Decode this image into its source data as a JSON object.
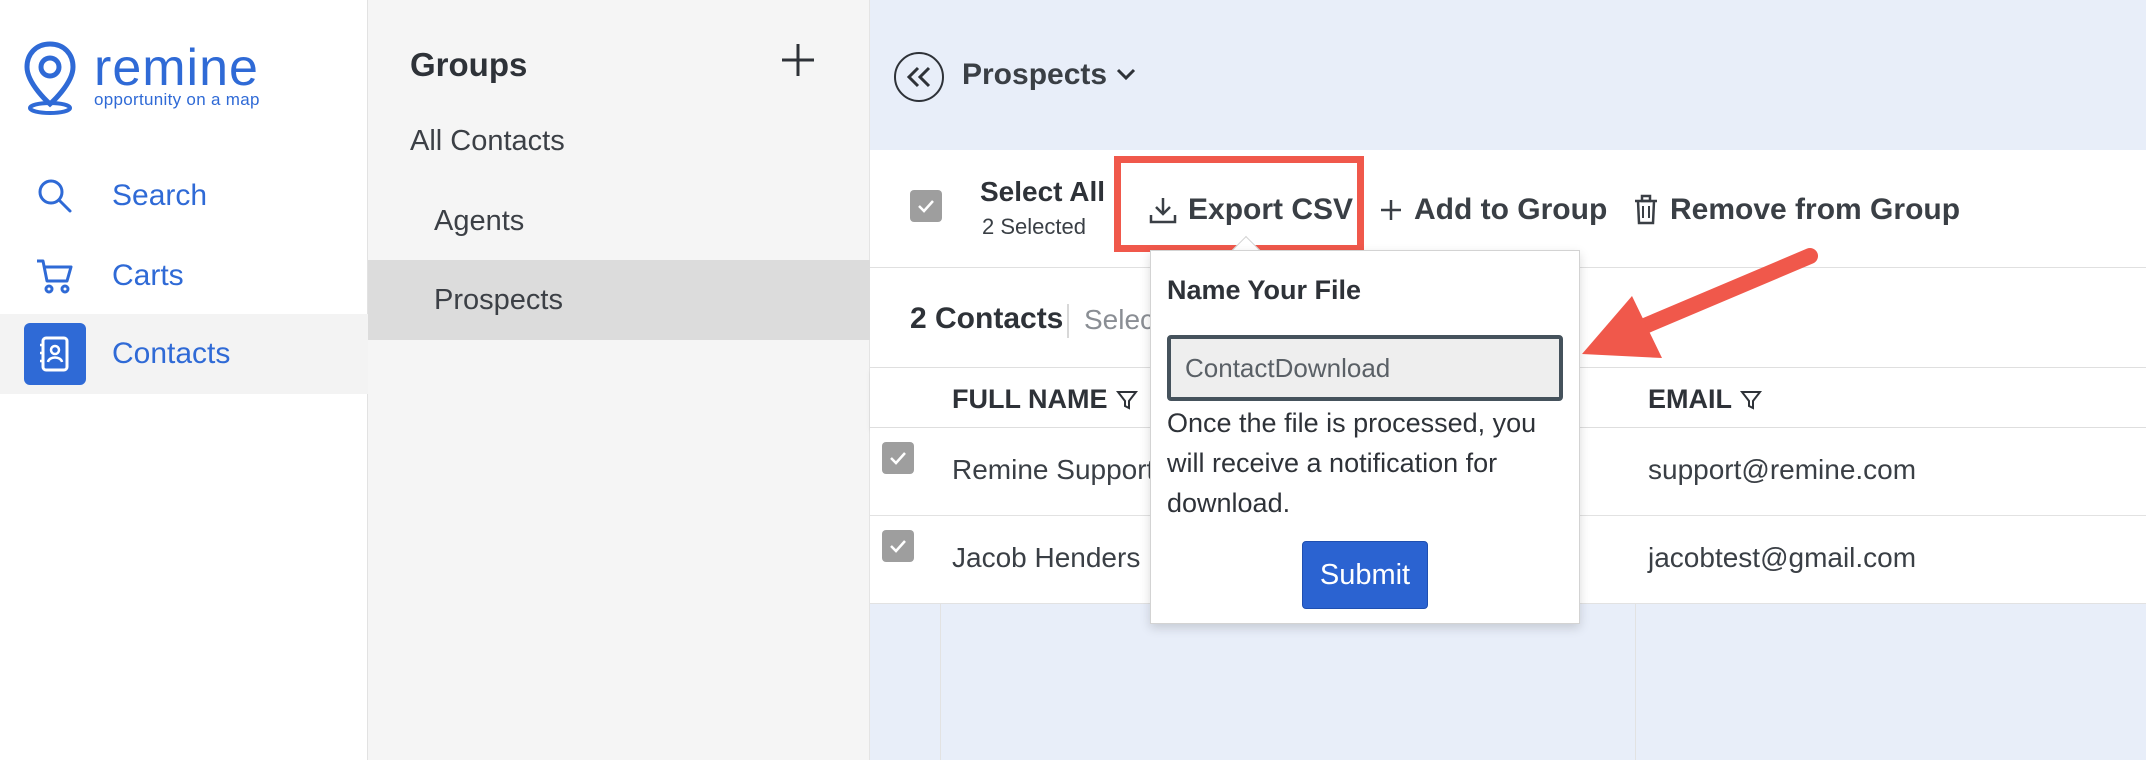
{
  "app": {
    "logo_name": "remine",
    "logo_tagline": "opportunity on a map",
    "brand_color": "#2f6ad6"
  },
  "sidebar": {
    "items": [
      {
        "label": "Search",
        "icon": "search-icon"
      },
      {
        "label": "Carts",
        "icon": "cart-icon"
      },
      {
        "label": "Contacts",
        "icon": "contacts-icon",
        "active": true
      }
    ]
  },
  "groups": {
    "title": "Groups",
    "all_label": "All Contacts",
    "items": [
      {
        "label": "Agents"
      },
      {
        "label": "Prospects",
        "selected": true
      }
    ]
  },
  "header": {
    "title": "Prospects"
  },
  "toolbar": {
    "select_all_label": "Select All",
    "selected_count": "2 Selected",
    "export_label": "Export CSV",
    "add_group_label": "Add to Group",
    "remove_group_label": "Remove from Group"
  },
  "contacts": {
    "count_label": "2 Contacts",
    "select_partial": "Selec"
  },
  "table": {
    "columns": {
      "name": "FULL NAME",
      "email": "EMAIL"
    },
    "rows": [
      {
        "name": "Remine Support",
        "email": "support@remine.com"
      },
      {
        "name": "Jacob Henders",
        "email": "jacobtest@gmail.com"
      }
    ]
  },
  "popup": {
    "title": "Name Your File",
    "input_value": "ContactDownload",
    "message": "Once the file is processed, you will receive a notification for download.",
    "submit_label": "Submit"
  },
  "annotation": {
    "highlight_color": "#f0584b"
  }
}
